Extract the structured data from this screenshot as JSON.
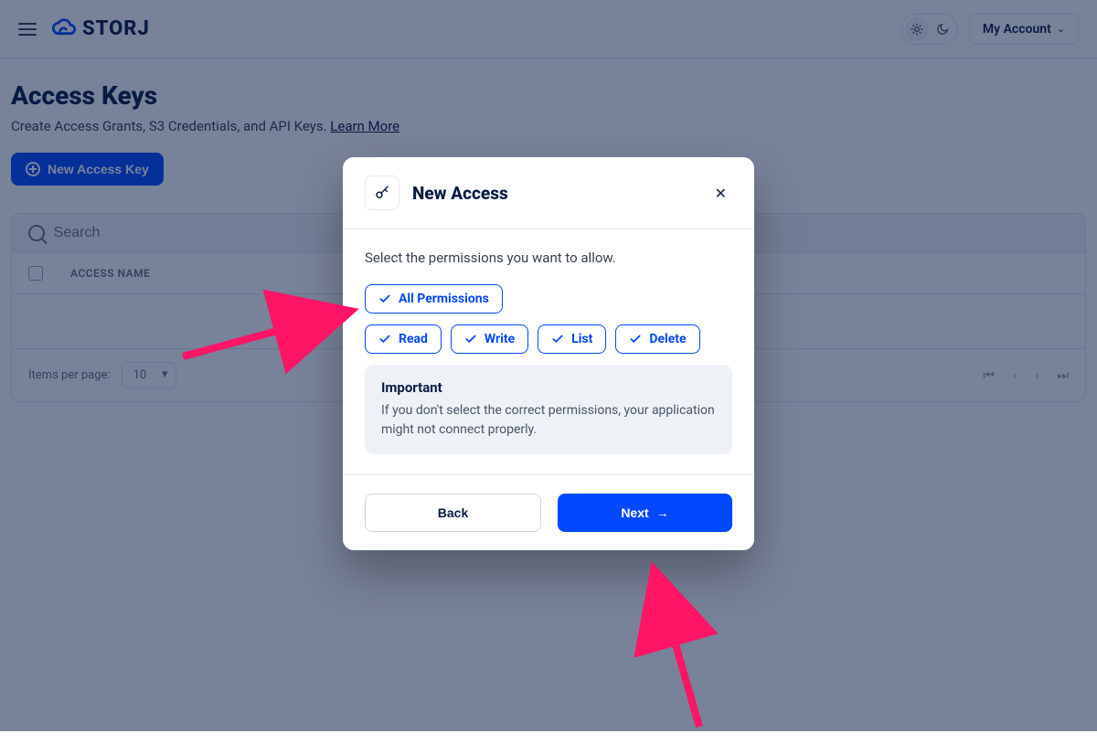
{
  "brand": "STORJ",
  "header": {
    "account_label": "My Account"
  },
  "page": {
    "title": "Access Keys",
    "subtitle_prefix": "Create Access Grants, S3 Credentials, and API Keys. ",
    "learn_more": "Learn More",
    "new_key_button": "New Access Key",
    "search_placeholder": "Search",
    "column_header": "ACCESS NAME",
    "items_per_page_label": "Items per page:",
    "items_per_page_value": "10"
  },
  "modal": {
    "title": "New Access",
    "prompt": "Select the permissions you want to allow.",
    "chips": {
      "all": "All Permissions",
      "read": "Read",
      "write": "Write",
      "list": "List",
      "delete": "Delete"
    },
    "info": {
      "title": "Important",
      "text": "If you don't select the correct permissions, your application might not connect properly."
    },
    "back": "Back",
    "next": "Next"
  }
}
